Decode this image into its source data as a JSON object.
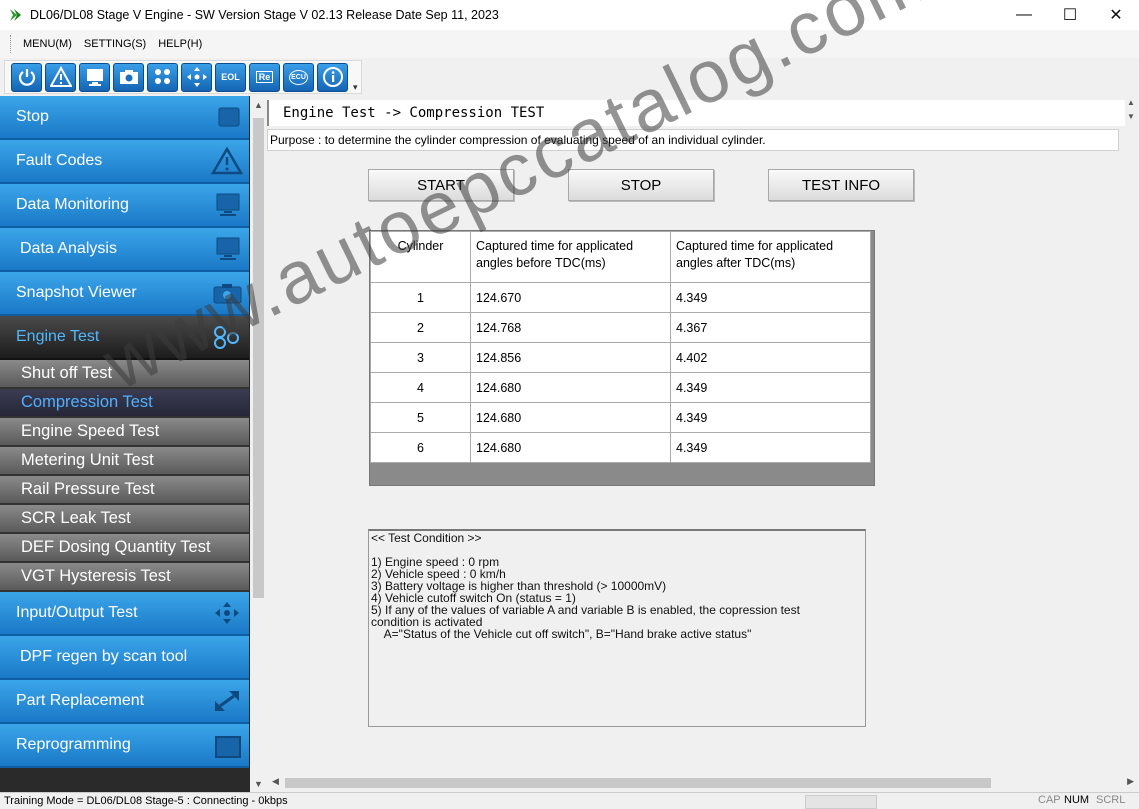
{
  "window": {
    "title": "DL06/DL08 Stage V Engine - SW Version Stage V 02.13 Release Date Sep 11, 2023",
    "controls": [
      "—",
      "☐",
      "✕"
    ]
  },
  "menu": [
    "MENU(M)",
    "SETTING(S)",
    "HELP(H)"
  ],
  "toolbar": {
    "buttons": [
      {
        "icon": "power-icon"
      },
      {
        "icon": "warning-icon"
      },
      {
        "icon": "monitor-icon"
      },
      {
        "icon": "camera-icon"
      },
      {
        "icon": "engine-icon"
      },
      {
        "icon": "move-icon"
      },
      {
        "icon": "eol-icon",
        "label": "EOL"
      },
      {
        "icon": "re-icon",
        "label": "Re"
      },
      {
        "icon": "ecu-icon",
        "label": "ECU"
      },
      {
        "icon": "info-icon"
      }
    ]
  },
  "sidebar": {
    "items": [
      {
        "label": "Stop",
        "icon": "stop-icon"
      },
      {
        "label": "Fault Codes",
        "icon": "warning-icon"
      },
      {
        "label": "Data Monitoring",
        "icon": "monitor-icon"
      },
      {
        "label": "Data Analysis",
        "icon": "monitor-icon"
      },
      {
        "label": "Snapshot Viewer",
        "icon": "camera-icon"
      },
      {
        "label": "Engine Test",
        "icon": "engine-icon"
      }
    ],
    "subitems": [
      "Shut off Test",
      "Compression Test",
      "Engine Speed Test",
      "Metering Unit Test",
      "Rail Pressure Test",
      "SCR Leak Test",
      "DEF Dosing Quantity Test",
      "VGT Hysteresis Test"
    ],
    "items_after": [
      {
        "label": "Input/Output Test",
        "icon": "move-icon"
      },
      {
        "label": "DPF regen by scan tool",
        "icon": ""
      },
      {
        "label": "Part Replacement",
        "icon": "replace-icon"
      },
      {
        "label": "Reprogramming",
        "icon": "re-icon"
      }
    ]
  },
  "main": {
    "breadcrumb": "Engine Test -> Compression TEST",
    "purpose": "Purpose : to determine the cylinder compression of evaluating speed of an individual cylinder.",
    "buttons": {
      "start": "START",
      "stop": "STOP",
      "info": "TEST INFO"
    },
    "table": {
      "headers": [
        "Cylinder",
        "Captured time for applicated angles before TDC(ms)",
        "Captured time for applicated angles after TDC(ms)"
      ],
      "rows": [
        [
          "1",
          "124.670",
          "4.349"
        ],
        [
          "2",
          "124.768",
          "4.367"
        ],
        [
          "3",
          "124.856",
          "4.402"
        ],
        [
          "4",
          "124.680",
          "4.349"
        ],
        [
          "5",
          "124.680",
          "4.349"
        ],
        [
          "6",
          "124.680",
          "4.349"
        ]
      ]
    },
    "test_condition": "<< Test Condition >>\n\n1) Engine speed : 0 rpm\n2) Vehicle speed : 0 km/h\n3) Battery voltage is higher than threshold (> 10000mV)\n4) Vehicle cutoff switch On (status = 1)\n5) If any of the values of variable A and variable B is enabled, the copression test\ncondition is activated\n    A=\"Status of the Vehicle cut off switch\", B=\"Hand brake active status\""
  },
  "status": {
    "text": "Training Mode = DL06/DL08 Stage-5 : Connecting - 0kbps",
    "cap": "CAP",
    "num": "NUM",
    "scrl": "SCRL"
  },
  "watermark": "www.autoepccatalog.com",
  "colors": {
    "sidebar_blue": "#1a78c6",
    "active_text": "#4fb8ff",
    "sub_gray": "#6e6e6e"
  }
}
